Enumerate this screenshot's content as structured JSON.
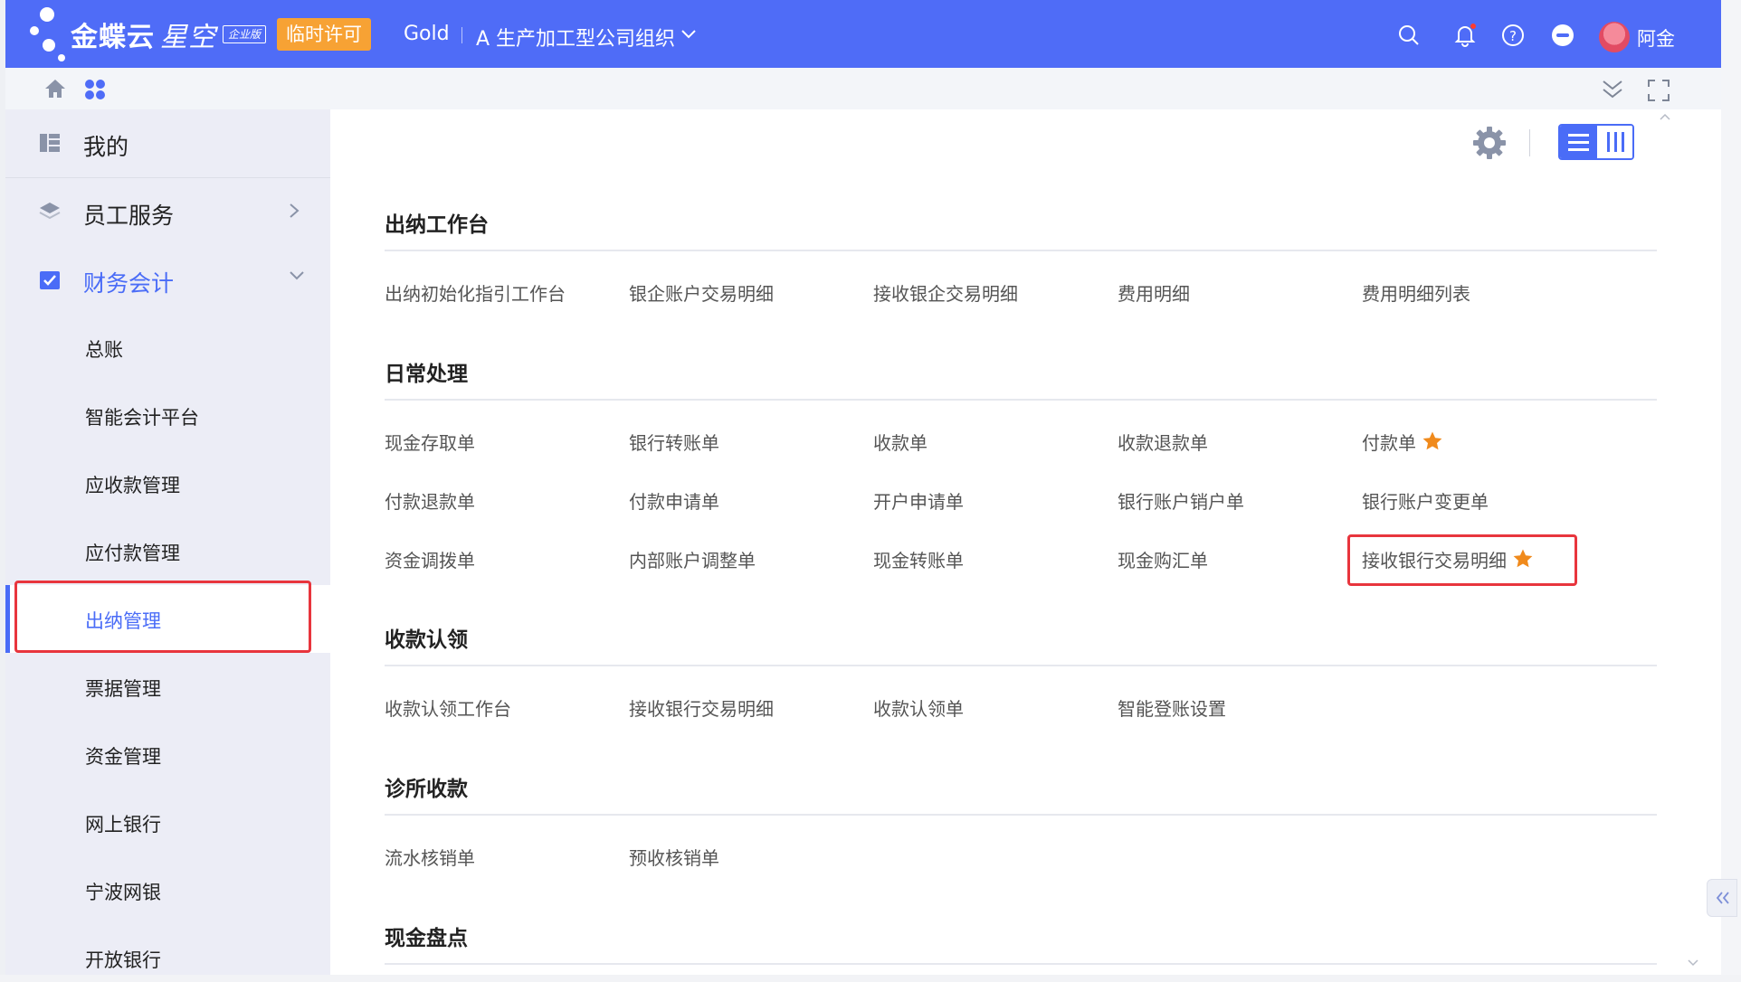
{
  "topbar": {
    "brand_main": "金蝶云",
    "brand_sub": "星空",
    "edition": "企业版",
    "license": "临时许可",
    "tenant": "Gold",
    "org": "A 生产加工型公司组织",
    "user_name": "阿金"
  },
  "sidebar": {
    "top_items": [
      {
        "label": "我的"
      },
      {
        "label": "员工服务"
      },
      {
        "label": "财务会计"
      }
    ],
    "sub_items": [
      {
        "label": "总账"
      },
      {
        "label": "智能会计平台"
      },
      {
        "label": "应收款管理"
      },
      {
        "label": "应付款管理"
      },
      {
        "label": "出纳管理"
      },
      {
        "label": "票据管理"
      },
      {
        "label": "资金管理"
      },
      {
        "label": "网上银行"
      },
      {
        "label": "宁波网银"
      },
      {
        "label": "开放银行"
      }
    ]
  },
  "sections": [
    {
      "title": "出纳工作台",
      "items": [
        "出纳初始化指引工作台",
        "银企账户交易明细",
        "接收银企交易明细",
        "费用明细",
        "费用明细列表"
      ]
    },
    {
      "title": "日常处理",
      "items": [
        "现金存取单",
        "银行转账单",
        "收款单",
        "收款退款单",
        "付款单",
        "付款退款单",
        "付款申请单",
        "开户申请单",
        "银行账户销户单",
        "银行账户变更单",
        "资金调拨单",
        "内部账户调整单",
        "现金转账单",
        "现金购汇单",
        "接收银行交易明细"
      ]
    },
    {
      "title": "收款认领",
      "items": [
        "收款认领工作台",
        "接收银行交易明细",
        "收款认领单",
        "智能登账设置"
      ]
    },
    {
      "title": "诊所收款",
      "items": [
        "流水核销单",
        "预收核销单"
      ]
    },
    {
      "title": "现金盘点",
      "items": []
    }
  ],
  "colors": {
    "accent": "#4f6cf7",
    "active": "#4a6cf7",
    "license_bg": "#f7a234",
    "star": "#f08a1c",
    "highlight_border": "#e8353d"
  }
}
